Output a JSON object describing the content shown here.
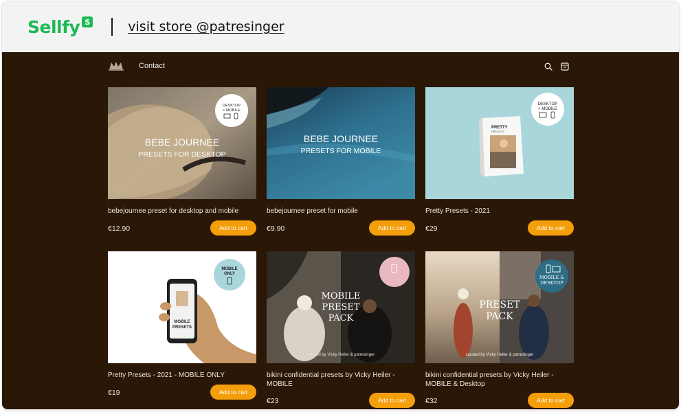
{
  "browser_header": {
    "brand": "Sellfy",
    "brand_badge": "S",
    "store_link": "visit store @patresinger"
  },
  "nav": {
    "contact": "Contact",
    "search_icon": "search-icon",
    "cart_icon": "shopping-bag-icon"
  },
  "colors": {
    "brand_green": "#1db954",
    "store_background": "#2a1706",
    "button_orange": "#f59e0b"
  },
  "products": [
    {
      "name": "bebejournee preset for desktop and mobile",
      "price": "€12.90",
      "button": "Add to cart",
      "image_line1": "BEBE JOURNEE",
      "image_line2": "PRESETS FOR DESKTOP",
      "badge_line1": "DESKTOP",
      "badge_line2": "+ MOBILE"
    },
    {
      "name": "bebejournee preset for mobile",
      "price": "€9.90",
      "button": "Add to cart",
      "image_line1": "BEBE JOURNEE",
      "image_line2": "PRESETS FOR MOBILE"
    },
    {
      "name": "Pretty Presets - 2021",
      "price": "€29",
      "button": "Add to cart",
      "box_title": "PRETTY",
      "box_subtitle": "PRESETS",
      "badge_line1": "DESKTOP",
      "badge_line2": "+ MOBILE"
    },
    {
      "name": "Pretty Presets - 2021 - MOBILE ONLY",
      "price": "€19",
      "button": "Add to cart",
      "phone_line1": "MOBILE",
      "phone_line2": "PRESETS",
      "badge_line1": "MOBILE",
      "badge_line2": "ONLY"
    },
    {
      "name": "bikini confidential presets by Vicky Heiler - MOBILE",
      "price": "€23",
      "button": "Add to cart",
      "image_line1": "MOBILE",
      "image_line2": "PRESET",
      "image_line3": "PACK",
      "credit": "curated by Vicky Heiler & patresinger"
    },
    {
      "name": "bikini confidential presets by Vicky Heiler - MOBILE & Desktop",
      "price": "€32",
      "button": "Add to cart",
      "image_line1": "PRESET",
      "image_line2": "PACK",
      "badge_line1": "MOBILE &",
      "badge_line2": "DESKTOP",
      "credit": "curated by Vicky Heiler & patresinger"
    }
  ]
}
